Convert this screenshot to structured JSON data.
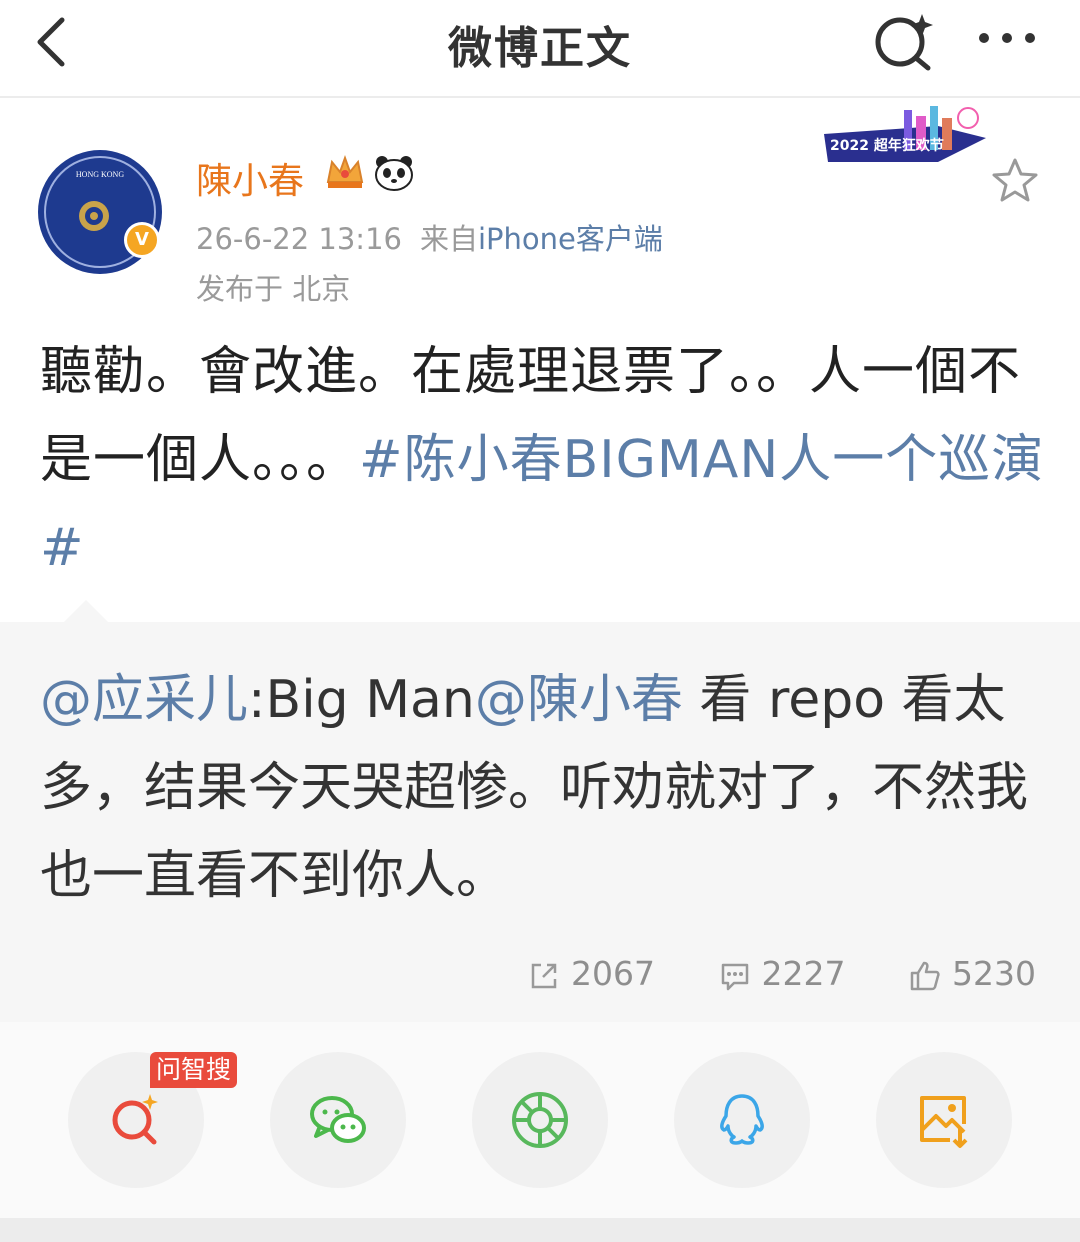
{
  "nav": {
    "title": "微博正文",
    "icons": [
      "back-arrow-icon",
      "search-sparkle-icon",
      "more-dots-icon"
    ]
  },
  "post": {
    "author": {
      "name": "陳小春",
      "avatar_text": "HONG KONG SPECIAL ADMINISTRATIVE REGION PEOPLE'S REPUBLIC OF CHINA",
      "verified_mark": "V",
      "badges": [
        "crown-badge-icon",
        "panda-badge-icon"
      ]
    },
    "timestamp": "26-6-22 13:16",
    "source_prefix": "来自",
    "source": "iPhone客户端",
    "location": "发布于 北京",
    "event_banner": "2022 超年狂欢节",
    "text_plain": "聽勸。會改進。在處理退票了。。人一個不是一個人。。。",
    "topic": "#陈小春BIGMAN人一个巡演#"
  },
  "repost": {
    "mention_user": "@应采儿",
    "text_before": ":Big Man",
    "mention_target": "@陳小春",
    "text_after": " 看 repo 看太多，结果今天哭超惨。听劝就对了，不然我也一直看不到你人。"
  },
  "stats": {
    "reposts": "2067",
    "comments": "2227",
    "likes": "5230"
  },
  "share": {
    "wzs_tag": "问智搜",
    "buttons": [
      "ai-search-icon",
      "wechat-icon",
      "moments-icon",
      "qq-icon",
      "save-image-icon"
    ]
  },
  "colors": {
    "username": "#e8761c",
    "link": "#5c7ea8",
    "meta": "#9a9a9a",
    "repost_bg": "#f6f6f6",
    "tag_red": "#e94b3c"
  }
}
